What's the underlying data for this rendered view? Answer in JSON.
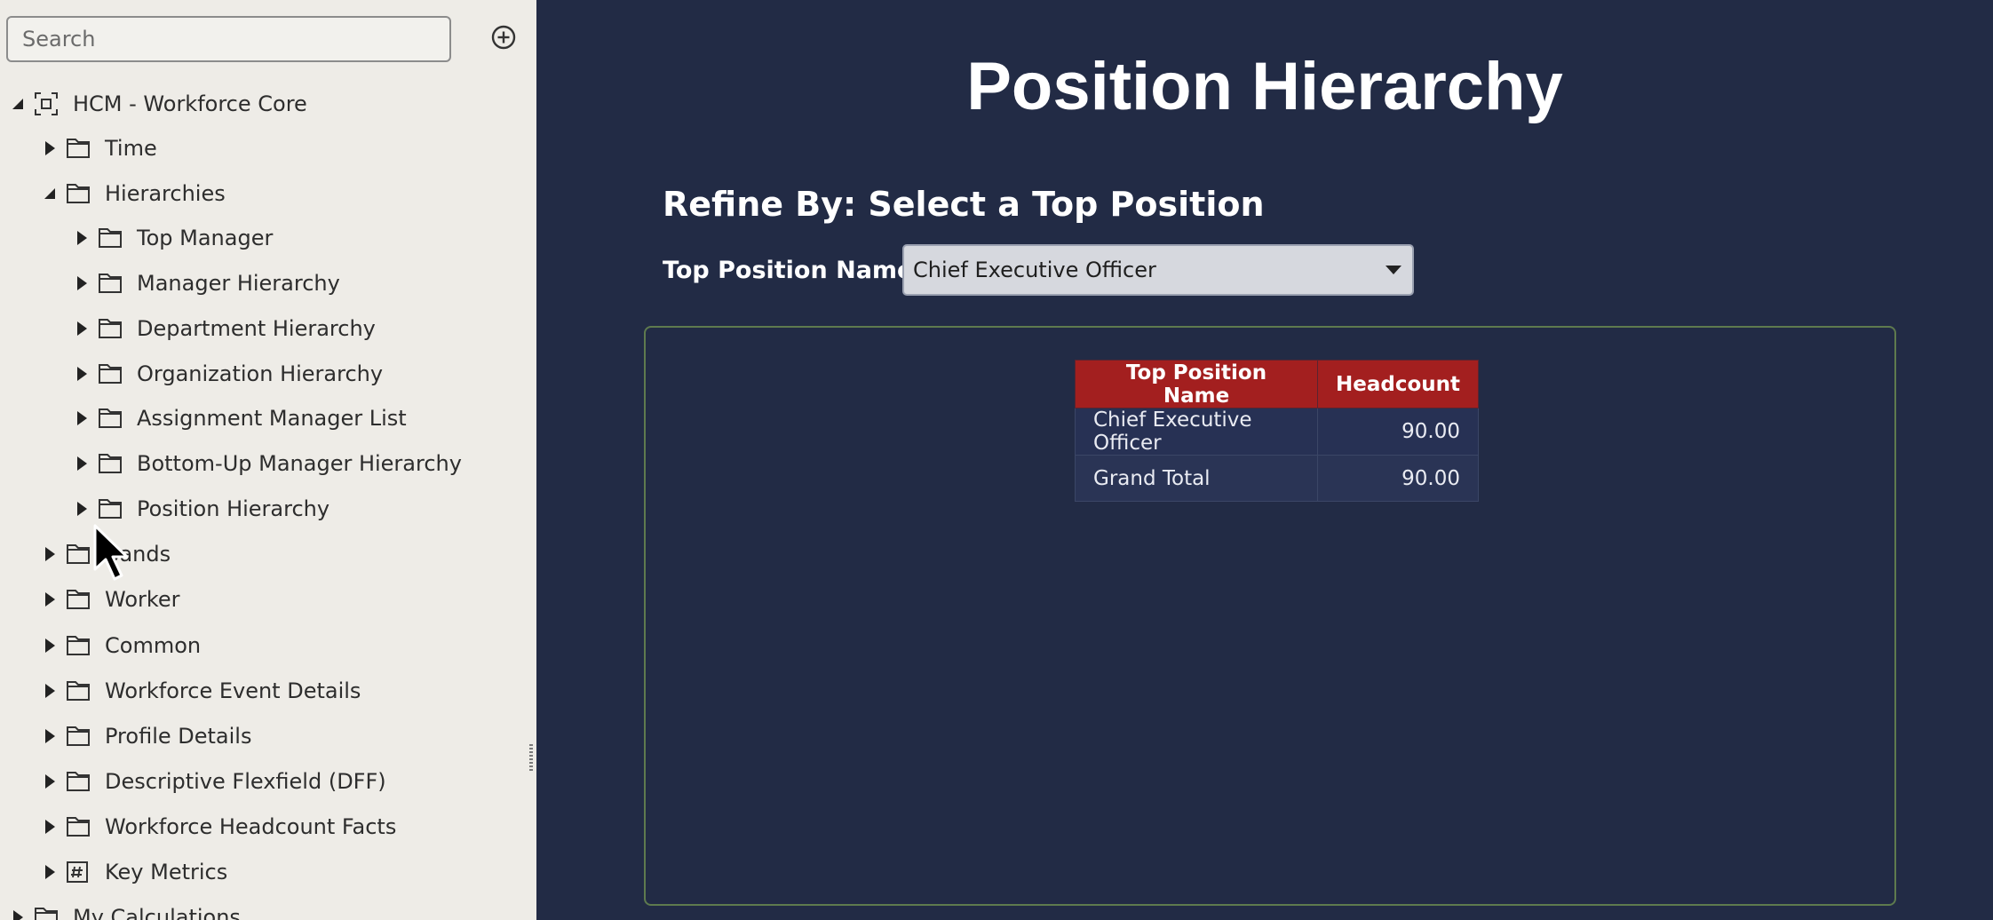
{
  "search": {
    "placeholder": "Search"
  },
  "tree": {
    "root": "HCM - Workforce Core",
    "items": [
      {
        "label": "Time"
      },
      {
        "label": "Hierarchies"
      },
      {
        "label": "Top Manager"
      },
      {
        "label": "Manager Hierarchy"
      },
      {
        "label": "Department Hierarchy"
      },
      {
        "label": "Organization Hierarchy"
      },
      {
        "label": "Assignment Manager List"
      },
      {
        "label": "Bottom-Up Manager Hierarchy"
      },
      {
        "label": "Position Hierarchy"
      },
      {
        "label": "Bands"
      },
      {
        "label": "Worker"
      },
      {
        "label": "Common"
      },
      {
        "label": "Workforce Event Details"
      },
      {
        "label": "Profile Details"
      },
      {
        "label": "Descriptive Flexfield (DFF)"
      },
      {
        "label": "Workforce Headcount Facts"
      },
      {
        "label": "Key Metrics"
      },
      {
        "label": "My Calculations"
      }
    ]
  },
  "dashboard": {
    "title": "Position Hierarchy",
    "refine_heading": "Refine By: Select a Top Position",
    "prompt_label": "Top Position Name",
    "prompt_value": "Chief Executive Officer"
  },
  "table": {
    "headers": [
      "Top Position Name",
      "Headcount"
    ],
    "rows": [
      {
        "name": "Chief Executive Officer",
        "value": "90.00"
      },
      {
        "name": "Grand Total",
        "value": "90.00"
      }
    ]
  },
  "colors": {
    "dashboard_bg": "#222b45",
    "table_header": "#a31f1f",
    "panel_bg": "#eeece7"
  }
}
